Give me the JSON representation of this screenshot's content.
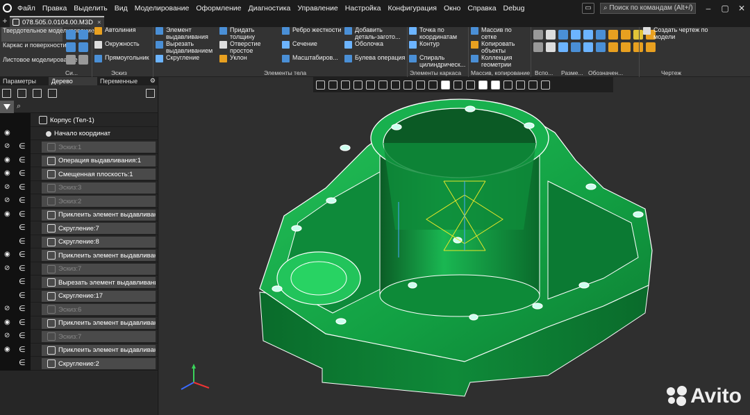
{
  "menubar": {
    "items": [
      "Файл",
      "Правка",
      "Выделить",
      "Вид",
      "Моделирование",
      "Оформление",
      "Диагностика",
      "Управление",
      "Настройка",
      "Конфигурация",
      "Окно",
      "Справка",
      "Debug"
    ],
    "search_placeholder": "Поиск по командам (Alt+/)"
  },
  "document_tab": {
    "title": "078.505.0.0104.00.M3D",
    "close": "×"
  },
  "ribbon": {
    "modes": [
      "Твердотельное моделирование",
      "Каркас и поверхности",
      "Листовое моделирование"
    ],
    "sketch_buttons": [
      "Автолиния",
      "Окружность",
      "Прямоугольник"
    ],
    "body_col1": [
      "Элемент выдавливания",
      "Вырезать выдавливанием",
      "Скругление"
    ],
    "body_col2": [
      "Придать толщину",
      "Отверстие простое",
      "Уклон"
    ],
    "body_col3": [
      "Ребро жесткости",
      "Сечение",
      "Масштабиров..."
    ],
    "body_col4": [
      "Добавить деталь-загото...",
      "Оболочка",
      "Булева операция"
    ],
    "frame_col": [
      "Точка по координатам",
      "Контур",
      "Спираль цилиндрическ..."
    ],
    "array_col": [
      "Массив по сетке",
      "Копировать объекты",
      "Коллекция геометрии"
    ],
    "drawing_btn": "Создать чертеж по модели",
    "sections": [
      "Си...",
      "Эскиз",
      "Элементы тела",
      "Элементы каркаса",
      "Массив, копирование",
      "Вспо...",
      "Разме...",
      "Обозначен...",
      "Чертеж"
    ]
  },
  "panel": {
    "tabs": [
      "Параметры",
      "Дерево",
      "Переменные"
    ],
    "filter_placeholder": "⌕",
    "tree": [
      {
        "label": "Корпус (Тел-1)",
        "icon": "part-icon",
        "eye": "",
        "dim": false,
        "level": "root"
      },
      {
        "label": "Начало координат",
        "icon": "origin-icon",
        "eye": "visible",
        "dim": false,
        "level": "child"
      },
      {
        "label": "Эскиз:1",
        "icon": "sketch-icon",
        "eye": "hidden",
        "dim": true,
        "level": "item"
      },
      {
        "label": "Операция выдавливания:1",
        "icon": "extrude-icon",
        "eye": "visible",
        "dim": false,
        "level": "item"
      },
      {
        "label": "Смещенная плоскость:1",
        "icon": "plane-icon",
        "eye": "visible",
        "dim": false,
        "level": "item"
      },
      {
        "label": "Эскиз:3",
        "icon": "sketch-icon",
        "eye": "hidden",
        "dim": true,
        "level": "item"
      },
      {
        "label": "Эскиз:2",
        "icon": "sketch-icon",
        "eye": "hidden",
        "dim": true,
        "level": "item"
      },
      {
        "label": "Приклеить элемент выдавливания",
        "icon": "extrude-icon",
        "eye": "visible",
        "dim": false,
        "level": "item"
      },
      {
        "label": "Скругление:7",
        "icon": "fillet-icon",
        "eye": "",
        "dim": false,
        "level": "item"
      },
      {
        "label": "Скругление:8",
        "icon": "fillet-icon",
        "eye": "",
        "dim": false,
        "level": "item"
      },
      {
        "label": "Приклеить элемент выдавливания",
        "icon": "extrude-icon",
        "eye": "visible",
        "dim": false,
        "level": "item"
      },
      {
        "label": "Эскиз:7",
        "icon": "sketch-icon",
        "eye": "hidden",
        "dim": true,
        "level": "item"
      },
      {
        "label": "Вырезать элемент выдавливания:",
        "icon": "cut-icon",
        "eye": "",
        "dim": false,
        "level": "item"
      },
      {
        "label": "Скругление:17",
        "icon": "fillet-icon",
        "eye": "",
        "dim": false,
        "level": "item"
      },
      {
        "label": "Эскиз:6",
        "icon": "sketch-icon",
        "eye": "hidden",
        "dim": true,
        "level": "item"
      },
      {
        "label": "Приклеить элемент выдавливания",
        "icon": "extrude-icon",
        "eye": "visible",
        "dim": false,
        "level": "item"
      },
      {
        "label": "Эскиз:7",
        "icon": "sketch-icon",
        "eye": "hidden",
        "dim": true,
        "level": "item"
      },
      {
        "label": "Приклеить элемент выдавливания",
        "icon": "extrude-icon",
        "eye": "visible",
        "dim": false,
        "level": "item"
      },
      {
        "label": "Скругление:2",
        "icon": "fillet-icon",
        "eye": "",
        "dim": false,
        "level": "item"
      }
    ]
  },
  "viewport": {
    "model_color": "#10a040",
    "edge_color": "#ffffff"
  },
  "watermark": "Avito"
}
